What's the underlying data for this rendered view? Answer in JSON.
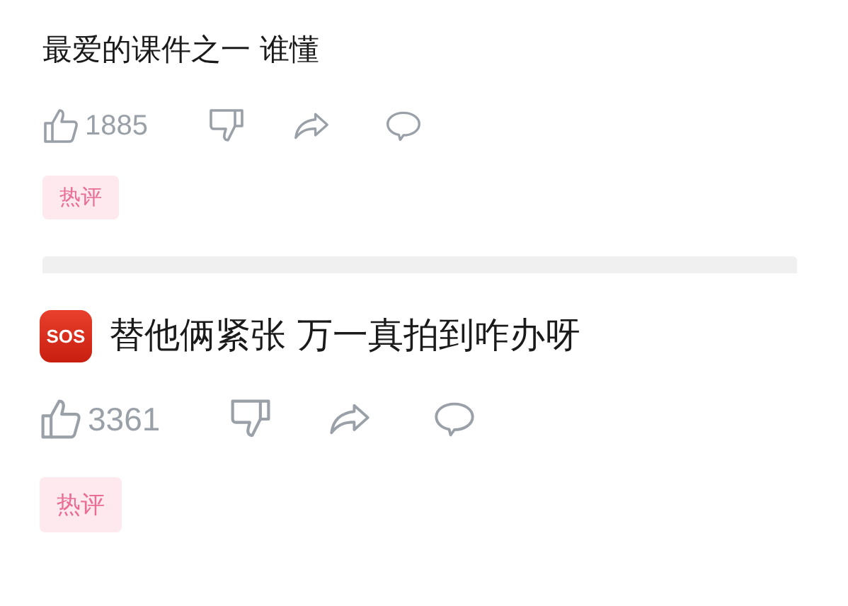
{
  "comments": [
    {
      "text": "最爱的课件之一 谁懂",
      "likes": "1885",
      "tag": "热评"
    },
    {
      "badge": "SOS",
      "text": "替他俩紧张 万一真拍到咋办呀",
      "likes": "3361",
      "tag": "热评"
    }
  ]
}
